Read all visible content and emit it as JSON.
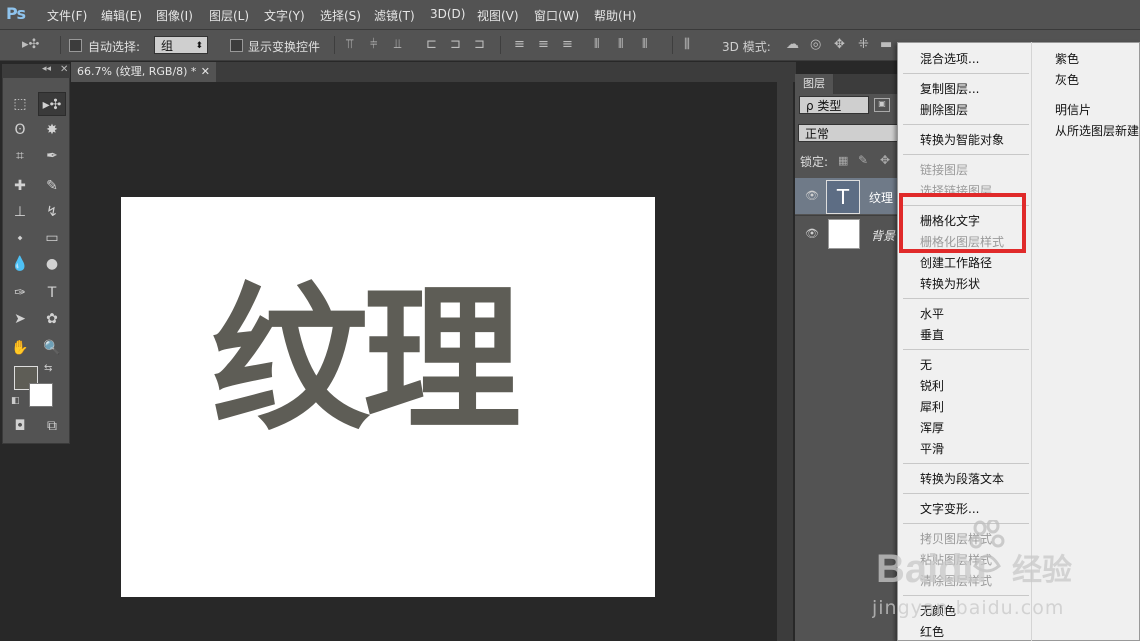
{
  "app": {
    "logo": "Ps"
  },
  "menubar": [
    "文件(F)",
    "编辑(E)",
    "图像(I)",
    "图层(L)",
    "文字(Y)",
    "选择(S)",
    "滤镜(T)",
    "3D(D)",
    "视图(V)",
    "窗口(W)",
    "帮助(H)"
  ],
  "options": {
    "auto_select_label": "自动选择:",
    "auto_select_value": "组",
    "show_transform_label": "显示变换控件",
    "mode_3d_label": "3D 模式:"
  },
  "document": {
    "tab_title": "66.7% (纹理, RGB/8) *",
    "canvas_text": "纹理"
  },
  "layers_panel": {
    "tab_label": "图层",
    "filter_label": "ρ 类型",
    "blend_mode": "正常",
    "lock_label": "锁定:",
    "layers": [
      {
        "name": "纹理",
        "type": "text",
        "thumb_glyph": "T"
      },
      {
        "name": "背景",
        "type": "background"
      }
    ]
  },
  "context_menu": {
    "left_items": [
      {
        "label": "混合选项...",
        "disabled": false
      },
      {
        "sep": true
      },
      {
        "label": "复制图层...",
        "disabled": false
      },
      {
        "label": "删除图层",
        "disabled": false
      },
      {
        "sep": true
      },
      {
        "label": "转换为智能对象",
        "disabled": false
      },
      {
        "sep": true
      },
      {
        "label": "链接图层",
        "disabled": true
      },
      {
        "label": "选择链接图层",
        "disabled": true
      },
      {
        "sep": true
      },
      {
        "label": "栅格化文字",
        "disabled": false
      },
      {
        "label": "栅格化图层样式",
        "disabled": true
      },
      {
        "label": "创建工作路径",
        "disabled": false
      },
      {
        "label": "转换为形状",
        "disabled": false
      },
      {
        "sep": true
      },
      {
        "label": "水平",
        "disabled": false
      },
      {
        "label": "垂直",
        "disabled": false
      },
      {
        "sep": true
      },
      {
        "label": "无",
        "disabled": false
      },
      {
        "label": "锐利",
        "disabled": false
      },
      {
        "label": "犀利",
        "disabled": false
      },
      {
        "label": "浑厚",
        "disabled": false
      },
      {
        "label": "平滑",
        "disabled": false
      },
      {
        "sep": true
      },
      {
        "label": "转换为段落文本",
        "disabled": false
      },
      {
        "sep": true
      },
      {
        "label": "文字变形...",
        "disabled": false
      },
      {
        "sep": true
      },
      {
        "label": "拷贝图层样式",
        "disabled": true
      },
      {
        "label": "粘贴图层样式",
        "disabled": true
      },
      {
        "label": "清除图层样式",
        "disabled": true
      },
      {
        "sep": true
      },
      {
        "label": "无颜色",
        "disabled": false
      },
      {
        "label": "红色",
        "disabled": false
      }
    ],
    "right_items": [
      "紫色",
      "灰色",
      "",
      "明信片",
      "从所选图层新建"
    ]
  },
  "watermark": {
    "brand": "Baidu",
    "brand_cn": "经验",
    "url": "jingyan.baidu.com"
  },
  "colors": {
    "highlight": "#e02a2a",
    "ps_blue": "#8fc4ee",
    "canvas_text": "#5e5d56"
  }
}
